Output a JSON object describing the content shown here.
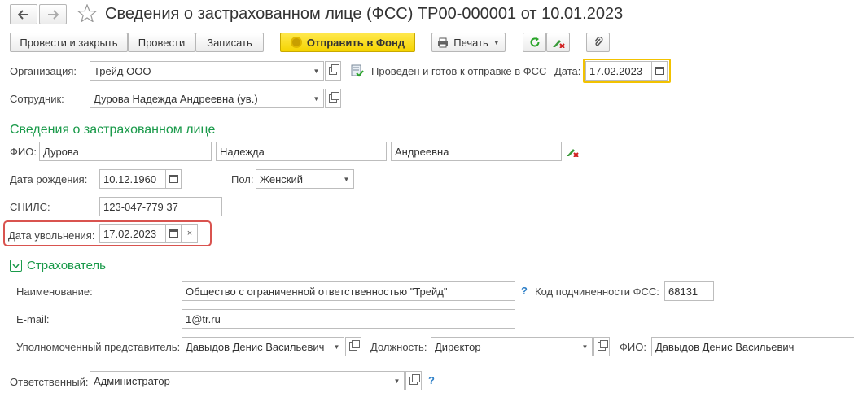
{
  "window": {
    "title": "Сведения о застрахованном лице (ФСС) ТР00-000001 от 10.01.2023"
  },
  "toolbar": {
    "post_close": "Провести и закрыть",
    "post": "Провести",
    "write": "Записать",
    "send_fund": "Отправить в Фонд",
    "print": "Печать"
  },
  "header": {
    "org_label": "Организация:",
    "org_value": "Трейд ООО",
    "status_text": "Проведен и готов к отправке в ФСС",
    "date_label": "Дата:",
    "date_value": "17.02.2023",
    "employee_label": "Сотрудник:",
    "employee_value": "Дурова Надежда Андреевна (ув.)"
  },
  "insured": {
    "section_title": "Сведения о застрахованном лице",
    "fio_label": "ФИО:",
    "last_name": "Дурова",
    "first_name": "Надежда",
    "middle_name": "Андреевна",
    "birth_label": "Дата рождения:",
    "birth_value": "10.12.1960",
    "gender_label": "Пол:",
    "gender_value": "Женский",
    "snils_label": "СНИЛС:",
    "snils_value": "123-047-779 37",
    "dismissal_label": "Дата увольнения:",
    "dismissal_value": "17.02.2023"
  },
  "insurer": {
    "section_title": "Страхователь",
    "name_label": "Наименование:",
    "name_value": "Общество с ограниченной ответственностью \"Трейд\"",
    "code_label": "Код подчиненности ФСС:",
    "code_value": "68131",
    "email_label": "E-mail:",
    "email_value": "1@tr.ru",
    "rep_label": "Уполномоченный представитель:",
    "rep_value": "Давыдов Денис Васильевич",
    "position_label": "Должность:",
    "position_value": "Директор",
    "fio_label": "ФИО:",
    "fio_value": "Давыдов Денис Васильевич"
  },
  "footer": {
    "responsible_label": "Ответственный:",
    "responsible_value": "Администратор"
  },
  "colors": {
    "accent_green": "#1a9a4a",
    "highlight_red": "#d9534f",
    "date_focus_border": "#f2c200",
    "send_button": "#f5d400"
  },
  "icons": [
    "back-arrow-icon",
    "forward-arrow-icon",
    "star-icon",
    "printer-icon",
    "refresh-icon",
    "edit-clear-icon",
    "paperclip-icon",
    "document-check-icon",
    "calendar-icon",
    "clear-icon",
    "help-icon",
    "chevron-down-icon",
    "open-icon"
  ]
}
